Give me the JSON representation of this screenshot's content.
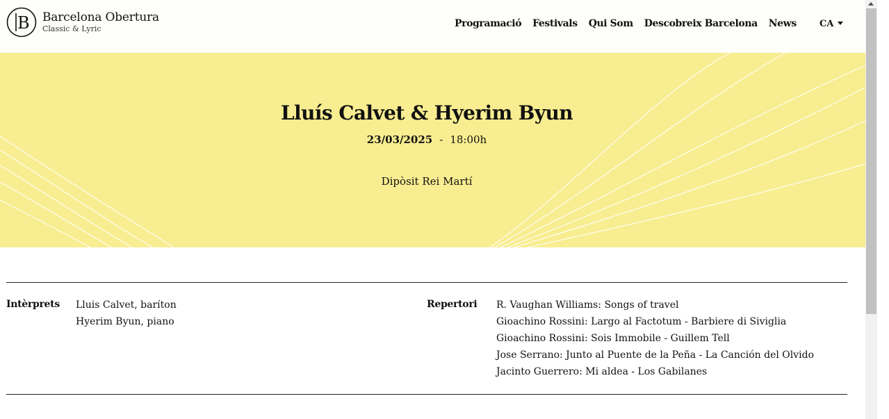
{
  "brand": {
    "name": "Barcelona Obertura",
    "tagline": "Classic & Lyric",
    "monogram": "B",
    "icon": "barcelona-obertura-logo-icon"
  },
  "nav": {
    "items": [
      {
        "label": "Programació"
      },
      {
        "label": "Festivals"
      },
      {
        "label": "Qui Som"
      },
      {
        "label": "Descobreix Barcelona"
      },
      {
        "label": "News"
      }
    ]
  },
  "language": {
    "selected": "CA",
    "icon": "caret-down-icon"
  },
  "event": {
    "title": "Lluís Calvet & Hyerim Byun",
    "date": "23/03/2025",
    "separator": "-",
    "time": "18:00h",
    "venue": "Dipòsit Rei Martí"
  },
  "details": {
    "performers_label": "Intèrprets",
    "performers": [
      "Lluis Calvet, baríton",
      "Hyerim Byun, piano"
    ],
    "repertoire_label": "Repertori",
    "repertoire": [
      "R. Vaughan Williams: Songs of travel",
      "Gioachino Rossini: Largo al Factotum - Barbiere di Siviglia",
      "Gioachino Rossini: Sois Immobile - Guillem Tell",
      "Jose Serrano: Junto al Puente de la Peña - La Canción del Olvido",
      "Jacinto Guerrero: Mi aldea - Los Gabilanes"
    ]
  },
  "colors": {
    "hero_background": "#f8ed90",
    "header_background": "#fefefa",
    "text": "#111111",
    "wave_lines": "#ffffff"
  }
}
